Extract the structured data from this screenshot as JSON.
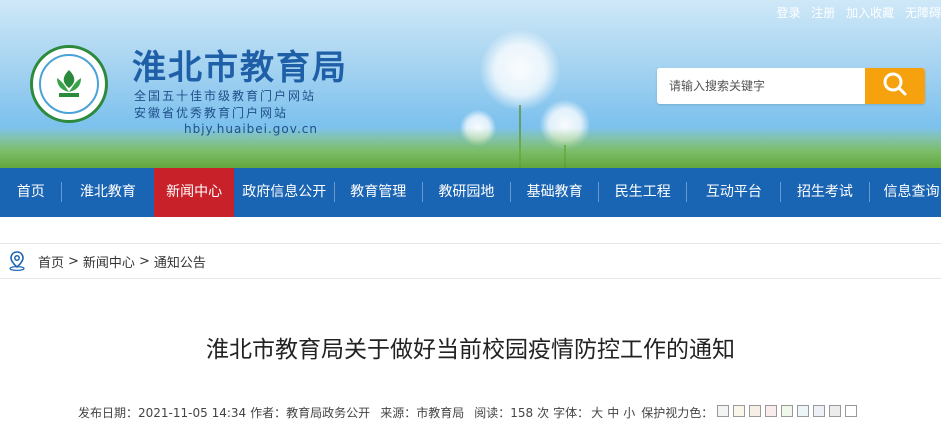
{
  "header": {
    "site_title": "淮北市教育局",
    "subtitle_1": "全国五十佳市级教育门户网站",
    "subtitle_2": "安徽省优秀教育门户网站",
    "url": "hbjy.huaibei.gov.cn",
    "logo_icon": "education-bureau-emblem-icon"
  },
  "toplinks": [
    "登录",
    "注册",
    "加入收藏",
    "无障碍"
  ],
  "search": {
    "placeholder": "请输入搜索关键字",
    "icon": "search-icon",
    "button_color": "#f5a20e"
  },
  "nav": {
    "items": [
      "首页",
      "淮北教育",
      "新闻中心",
      "政府信息公开",
      "教育管理",
      "教研园地",
      "基础教育",
      "民生工程",
      "互动平台",
      "招生考试",
      "信息查询"
    ],
    "active_index": 2,
    "bg_color": "#1a64b4",
    "active_color": "#c8212a"
  },
  "breadcrumb": {
    "icon": "location-pin-icon",
    "items": [
      "首页",
      "新闻中心",
      "通知公告"
    ],
    "separator": ">"
  },
  "article": {
    "title": "淮北市教育局关于做好当前校园疫情防控工作的通知",
    "published_label": "发布日期：",
    "published": "2021-11-05 14:34",
    "author_label": "作者：",
    "author": "教育局政务公开",
    "source_label": "来源：",
    "source": "市教育局",
    "views_label": "阅读：",
    "views": "158",
    "views_unit": "次",
    "font_label": "字体：",
    "font_sizes": [
      "大",
      "中",
      "小"
    ],
    "eye_care_label": "保护视力色：",
    "eye_care_colors": [
      "#f4f4f4",
      "#faf6e9",
      "#f6efe6",
      "#f8ecec",
      "#f0f8ec",
      "#ecf6f8",
      "#eef0f8",
      "#ececec",
      "#ffffff"
    ]
  }
}
